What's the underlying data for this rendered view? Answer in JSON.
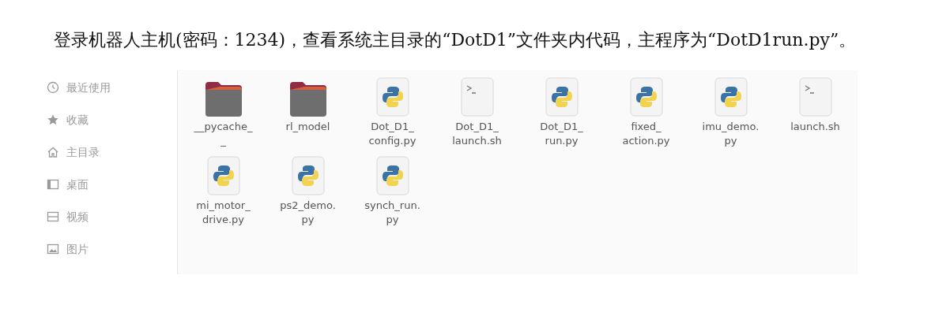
{
  "paragraph": "登录机器人主机(密码：1234)，查看系统主目录的“DotD1”文件夹内代码，主程序为“DotD1run.py”。",
  "sidebar": {
    "items": [
      {
        "label": "最近使用",
        "kind": "clock"
      },
      {
        "label": "收藏",
        "kind": "star"
      },
      {
        "label": "主目录",
        "kind": "home"
      },
      {
        "label": "桌面",
        "kind": "desktop"
      },
      {
        "label": "视频",
        "kind": "video"
      },
      {
        "label": "图片",
        "kind": "image"
      }
    ]
  },
  "files": [
    {
      "kind": "folder",
      "lines": [
        "__pycache_",
        "_"
      ]
    },
    {
      "kind": "folder",
      "lines": [
        "rl_model"
      ]
    },
    {
      "kind": "python",
      "lines": [
        "Dot_D1_",
        "config.py"
      ]
    },
    {
      "kind": "shell",
      "lines": [
        "Dot_D1_",
        "launch.sh"
      ]
    },
    {
      "kind": "python",
      "lines": [
        "Dot_D1_",
        "run.py"
      ]
    },
    {
      "kind": "python",
      "lines": [
        "fixed_",
        "action.py"
      ]
    },
    {
      "kind": "python",
      "lines": [
        "imu_demo.",
        "py"
      ]
    },
    {
      "kind": "shell",
      "lines": [
        "launch.sh"
      ]
    },
    {
      "kind": "python",
      "lines": [
        "mi_motor_",
        "drive.py"
      ]
    },
    {
      "kind": "python",
      "lines": [
        "ps2_demo.",
        "py"
      ]
    },
    {
      "kind": "python",
      "lines": [
        "synch_run.",
        "py"
      ]
    }
  ]
}
